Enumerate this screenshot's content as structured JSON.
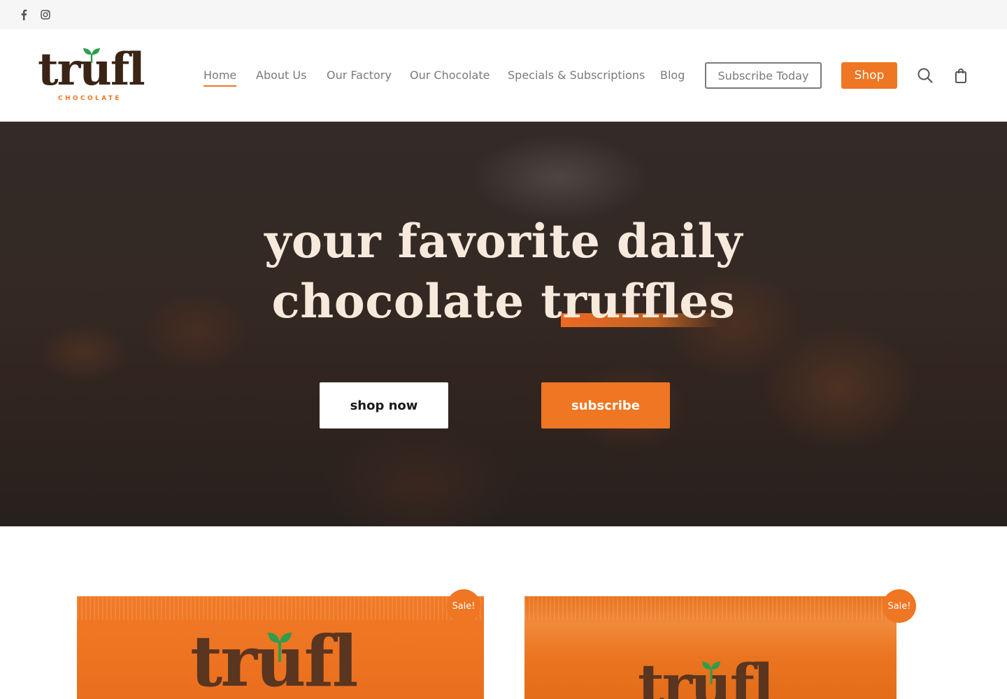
{
  "topbar": {
    "icons": [
      "facebook-icon",
      "instagram-icon"
    ]
  },
  "header": {
    "logo_word": "trufl",
    "logo_sub": "CHOCOLATE",
    "nav": [
      {
        "label": "Home",
        "active": true
      },
      {
        "label": "About Us"
      },
      {
        "label": "Our Factory"
      },
      {
        "label": "Our Chocolate"
      },
      {
        "label": "Specials & Subscriptions"
      },
      {
        "label": "Blog"
      }
    ],
    "subscribe_label": "Subscribe Today",
    "shop_label": "Shop",
    "icons": [
      "search-icon",
      "cart-bag-icon"
    ]
  },
  "hero": {
    "title_line1": "your favorite daily",
    "title_line2": "chocolate truffles",
    "primary_button": "shop now",
    "secondary_button": "subscribe"
  },
  "products": [
    {
      "badge": "Sale!",
      "bag_word": "trufl"
    },
    {
      "badge": "Sale!",
      "bag_word": "trufl"
    }
  ],
  "colors": {
    "accent": "#ef7622",
    "brown": "#3a2416",
    "hero_text": "#f7e9dc",
    "nav_text": "#7a7a7a"
  }
}
